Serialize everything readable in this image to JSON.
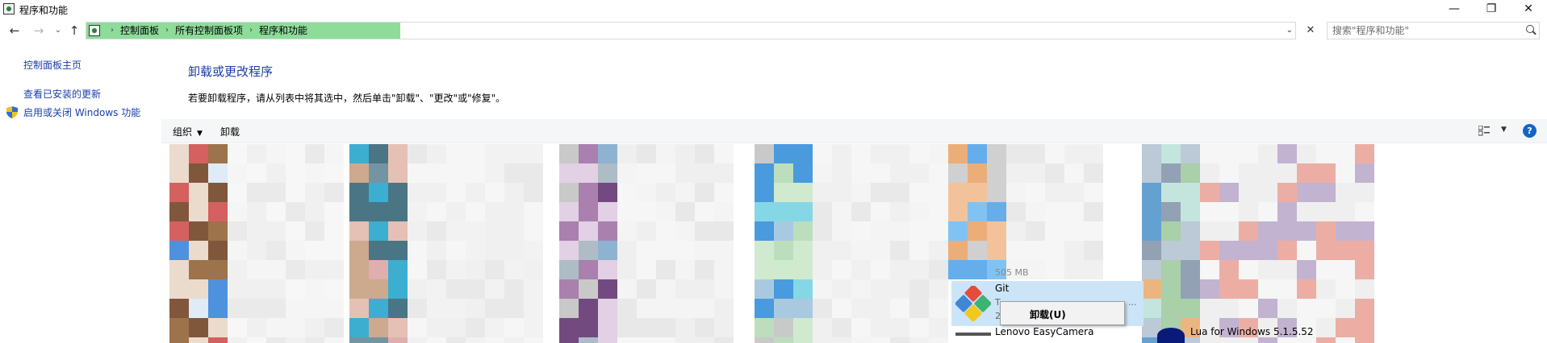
{
  "window": {
    "title": "程序和功能",
    "minimize_label": "—",
    "maximize_label": "❐",
    "close_label": "✕"
  },
  "nav": {
    "back": "←",
    "forward": "→",
    "recent": "⌄",
    "up": "↑"
  },
  "address": {
    "crumbs": [
      "控制面板",
      "所有控制面板项",
      "程序和功能"
    ],
    "separator": "›",
    "dropdown": "⌄",
    "clear": "✕",
    "loading_progress": 0.26
  },
  "search": {
    "placeholder": "搜索\"程序和功能\""
  },
  "sidebar": {
    "home": "控制面板主页",
    "updates": "查看已安装的更新",
    "features": "启用或关闭 Windows 功能"
  },
  "main": {
    "title": "卸载或更改程序",
    "description": "若要卸载程序，请从列表中将其选中，然后单击\"卸载\"、\"更改\"或\"修复\"。"
  },
  "toolbar": {
    "organize": "组织",
    "organize_caret": "▼",
    "uninstall": "卸载",
    "view_caret": "▼",
    "help": "?"
  },
  "programs": {
    "size_text": "505 MB",
    "selected": {
      "name": "Git",
      "line2": "T",
      "line3": "2",
      "trunc": "..."
    },
    "lenovo": "Lenovo EasyCamera",
    "lua": "Lua for Windows 5.1.5.52"
  },
  "context_menu": {
    "item": "卸载(U)"
  },
  "colors": {
    "link": "#1a3ea8",
    "address_progress": "#8ddc9a",
    "selection": "#cce4f7",
    "help": "#1366c5"
  }
}
